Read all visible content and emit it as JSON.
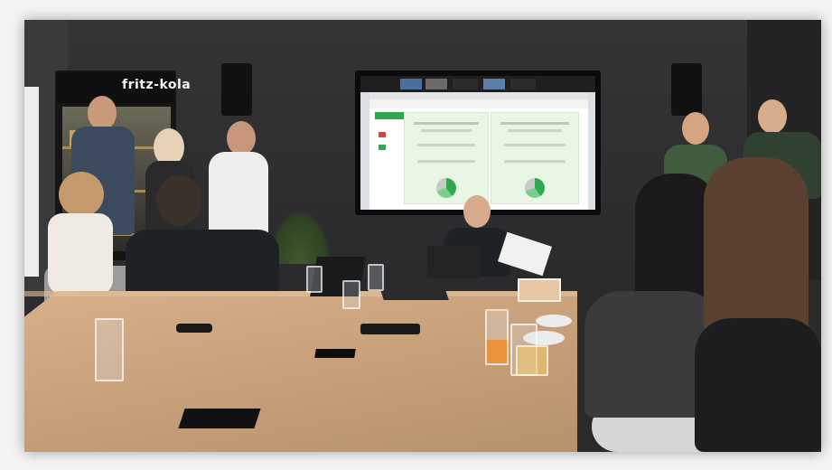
{
  "scene": {
    "fridge_brand": "fritz-kola",
    "screen": {
      "call_tiles": 5,
      "slide_app_name": "",
      "slide_title": ""
    }
  },
  "colors": {
    "wall": "#2c2c2e",
    "table": "#c9a27c",
    "screen_green": "#2fa84f"
  }
}
